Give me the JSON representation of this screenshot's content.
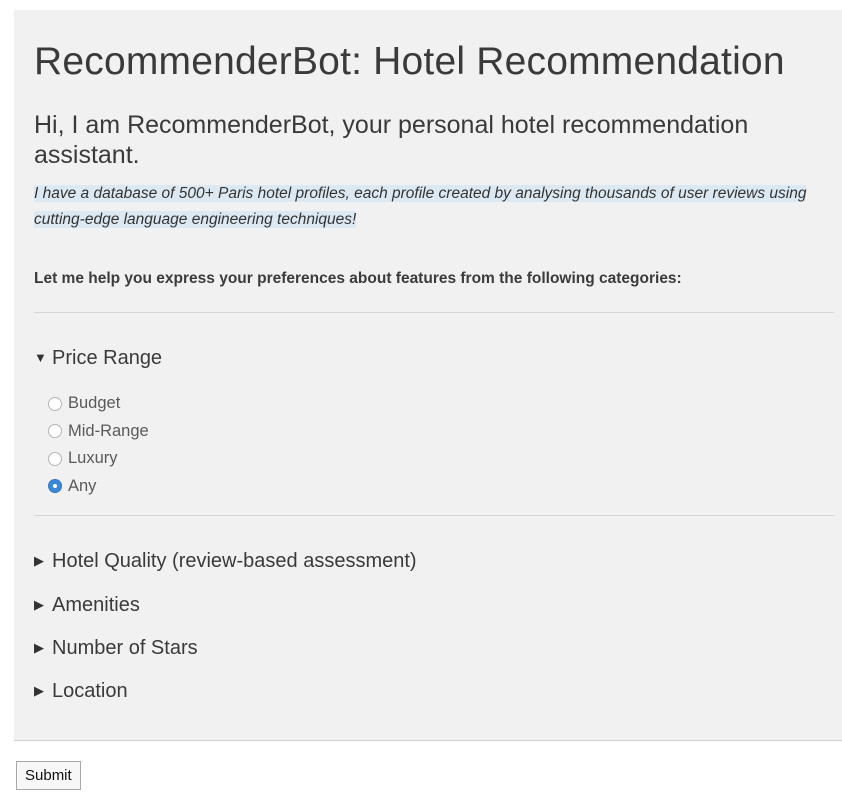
{
  "header": {
    "title": "RecommenderBot: Hotel Recommendation",
    "greeting": "Hi, I am RecommenderBot, your personal hotel recommendation assistant.",
    "intro": "I have a database of 500+ Paris hotel profiles, each profile created by analysing thousands of user reviews using cutting-edge language engineering techniques!",
    "prompt": "Let me help you express your preferences about features from the following categories:"
  },
  "sections": [
    {
      "label": "Price Range",
      "expanded": true,
      "expander_icon": "triangle-down-icon",
      "options": [
        {
          "label": "Budget",
          "checked": false
        },
        {
          "label": "Mid-Range",
          "checked": false
        },
        {
          "label": "Luxury",
          "checked": false
        },
        {
          "label": "Any",
          "checked": true
        }
      ]
    },
    {
      "label": "Hotel Quality (review-based assessment)",
      "expanded": false,
      "expander_icon": "triangle-right-icon"
    },
    {
      "label": "Amenities",
      "expanded": false,
      "expander_icon": "triangle-right-icon"
    },
    {
      "label": "Number of Stars",
      "expanded": false,
      "expander_icon": "triangle-right-icon"
    },
    {
      "label": "Location",
      "expanded": false,
      "expander_icon": "triangle-right-icon"
    }
  ],
  "icons": {
    "expanded": "▼",
    "collapsed": "▶"
  },
  "form": {
    "submit_label": "Submit"
  },
  "colors": {
    "panel_bg": "#f1f1f1",
    "intro_highlight": "#dde9f2",
    "radio_checked": "#3b88d9"
  }
}
